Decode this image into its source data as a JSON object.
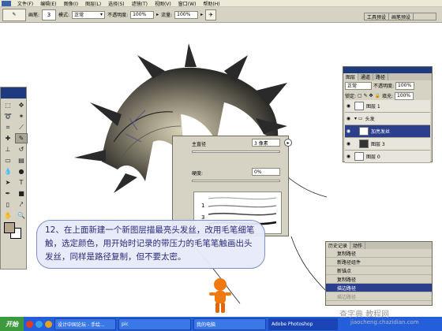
{
  "menubar": {
    "items": [
      "文件(F)",
      "编辑(E)",
      "图像(I)",
      "图层(L)",
      "选择(S)",
      "滤镜(T)",
      "视图(V)",
      "窗口(W)",
      "帮助(H)"
    ]
  },
  "options_bar": {
    "brush_label": "画笔:",
    "brush_size": "3",
    "mode_label": "模式:",
    "mode_value": "正常",
    "opacity_label": "不透明度:",
    "opacity_value": "100%",
    "flow_label": "流量:",
    "flow_value": "100%",
    "airbrush_icon": "airbrush-icon",
    "presets_tab": "工具预设",
    "brushes_tab": "画笔预设"
  },
  "brush_popup": {
    "diameter_label": "主直径",
    "diameter_value": "3 像素",
    "hardness_label": "硬度:",
    "hardness_value": "0%",
    "list_numbers": [
      "1",
      "3"
    ]
  },
  "layers_panel": {
    "tabs": [
      "图层",
      "通道",
      "路径"
    ],
    "blend_mode": "正常",
    "opacity_label": "不透明度:",
    "opacity_value": "100%",
    "lock_label": "锁定:",
    "fill_label": "填充:",
    "fill_value": "100%",
    "layers": [
      {
        "name": "图层 1",
        "selected": false
      },
      {
        "name": "头发",
        "selected": false
      },
      {
        "name": "加亮发丝",
        "selected": true
      },
      {
        "name": "图层 3",
        "selected": false
      },
      {
        "name": "图层 0",
        "selected": false
      }
    ]
  },
  "history_panel": {
    "tabs": [
      "历史记录",
      "动作"
    ],
    "items": [
      {
        "label": "复制路径",
        "state": "normal"
      },
      {
        "label": "新路径组件",
        "state": "normal"
      },
      {
        "label": "新锚点",
        "state": "normal"
      },
      {
        "label": "复制路径",
        "state": "normal"
      },
      {
        "label": "描边路径",
        "state": "selected"
      },
      {
        "label": "描边路径",
        "state": "dim"
      }
    ]
  },
  "caption": {
    "text": "12、在上面新建一个新图层描最亮头发丝，改用毛笔细笔触，选定颜色，用开始时记录的带压力的毛笔笔触画出头发丝，同样是路径复制，但不要太密。"
  },
  "taskbar": {
    "start_label": "开始",
    "tasks": [
      "设计中国论坛 - 手绘...",
      "pic",
      "我的电脑",
      "Adobe Photoshop"
    ]
  },
  "watermark": {
    "text": "查字典 教程网",
    "sub": "jiaocheng.chazidian.com"
  },
  "colors": {
    "title_blue": "#1e3a80",
    "panel_gray": "#d6d3c4",
    "caption_text": "#2a2a78",
    "taskbar_blue": "#245edb"
  }
}
